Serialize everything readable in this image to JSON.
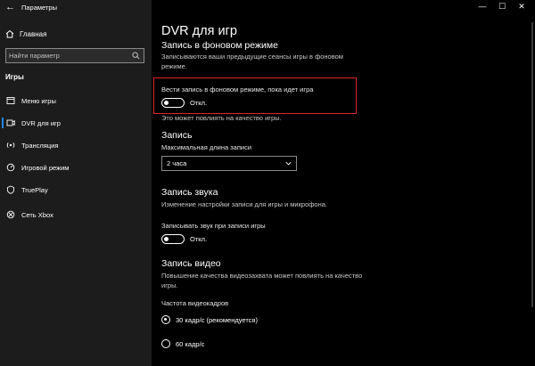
{
  "window": {
    "title": "Параметры",
    "minimize": "—",
    "maximize": "☐",
    "close": "✕"
  },
  "sidebar": {
    "home_label": "Главная",
    "search": {
      "placeholder": "Найти параметр"
    },
    "section_title": "Игры",
    "items": [
      {
        "label": "Меню игры",
        "icon": "game-menu-icon"
      },
      {
        "label": "DVR для игр",
        "icon": "dvr-icon",
        "active": true
      },
      {
        "label": "Трансляция",
        "icon": "broadcast-icon"
      },
      {
        "label": "Игровой режим",
        "icon": "game-mode-icon"
      },
      {
        "label": "TruePlay",
        "icon": "trueplay-icon"
      },
      {
        "label": "Сеть Xbox",
        "icon": "xbox-icon"
      }
    ]
  },
  "main": {
    "title": "DVR для игр",
    "background": {
      "heading": "Запись в фоновом режиме",
      "description_line1": "Записываются ваши предыдущие сеансы игры в фоновом",
      "description_line2": "режиме.",
      "toggle_label": "Вести запись в фоновом режиме, пока идет игра",
      "toggle_state": "Откл.",
      "note": "Это может повлиять на качество игры."
    },
    "record": {
      "heading": "Запись",
      "max_length_label": "Максимальная длина записи",
      "max_length_value": "2 часа"
    },
    "audio": {
      "heading": "Запись звука",
      "description": "Изменение настройки записи для игры и микрофона.",
      "toggle_label": "Записывать звук при записи игры",
      "toggle_state": "Откл."
    },
    "video": {
      "heading": "Запись видео",
      "description_line1": "Повышение качества видеозахвата может повлиять на качество",
      "description_line2": "игры.",
      "fps_label": "Частота видеокадров",
      "fps_options": [
        {
          "label": "30 кадр/с (рекомендуется)",
          "checked": true
        },
        {
          "label": "60 кадр/с",
          "checked": false
        }
      ]
    }
  },
  "colors": {
    "background": "#000000",
    "sidebar": "#1c1c1c",
    "accent": "#1e88e5",
    "highlight": "#d9262c"
  }
}
